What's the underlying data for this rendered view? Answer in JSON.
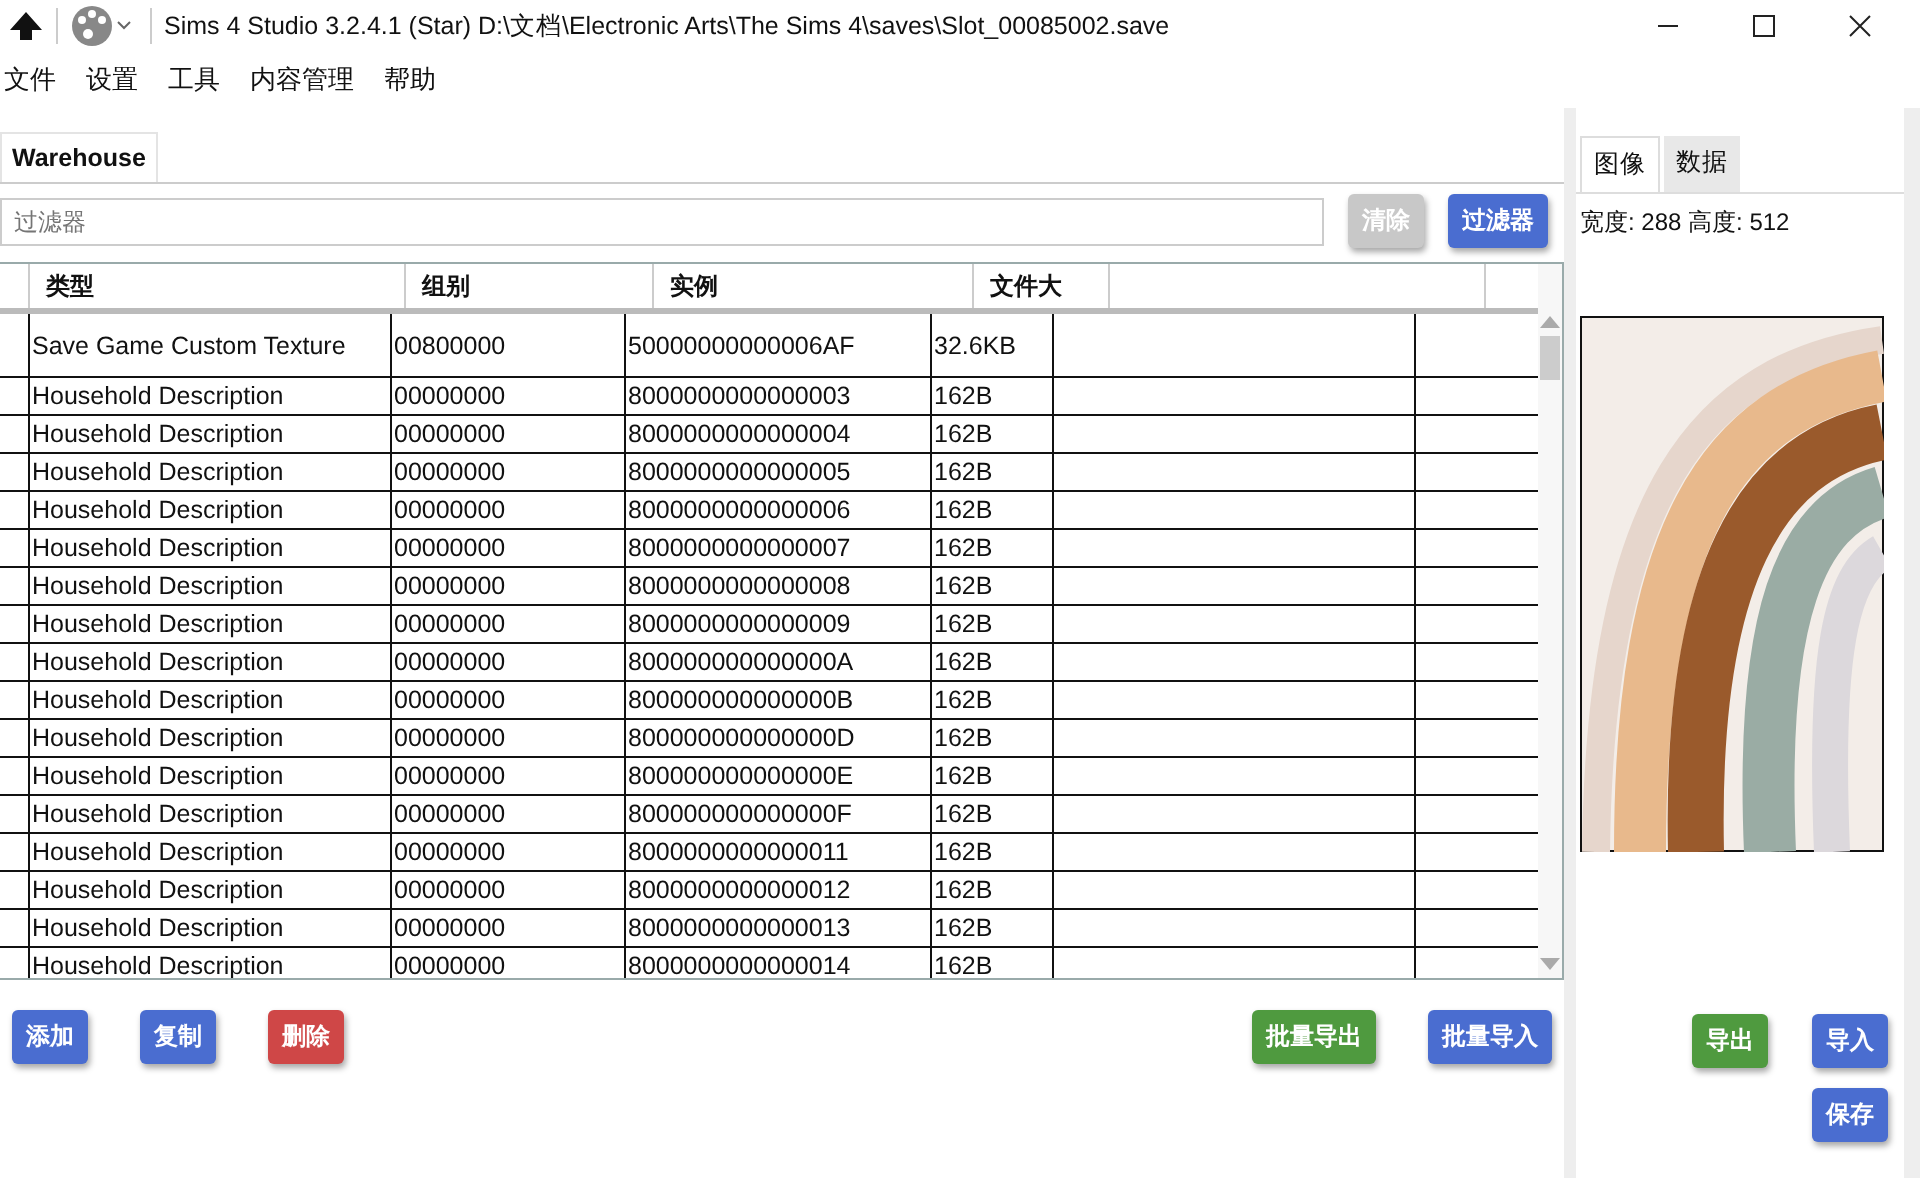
{
  "window": {
    "title": "Sims 4 Studio 3.2.4.1 (Star)  D:\\文档\\Electronic Arts\\The Sims 4\\saves\\Slot_00085002.save"
  },
  "menu": [
    "文件",
    "设置",
    "工具",
    "内容管理",
    "帮助"
  ],
  "tabs": [
    {
      "label": "Warehouse",
      "selected": true
    }
  ],
  "filter": {
    "placeholder": "过滤器",
    "clear_button": "清除",
    "filter_button": "过滤器"
  },
  "table": {
    "columns": [
      "类型",
      "组别",
      "实例",
      "文件大"
    ],
    "rows": [
      {
        "type": "Save Game Custom Texture",
        "group": "00800000",
        "instance": "50000000000006AF",
        "size": "32.6KB",
        "tall": true
      },
      {
        "type": "Household Description",
        "group": "00000000",
        "instance": "8000000000000003",
        "size": "162B",
        "tall": false
      },
      {
        "type": "Household Description",
        "group": "00000000",
        "instance": "8000000000000004",
        "size": "162B",
        "tall": false
      },
      {
        "type": "Household Description",
        "group": "00000000",
        "instance": "8000000000000005",
        "size": "162B",
        "tall": false
      },
      {
        "type": "Household Description",
        "group": "00000000",
        "instance": "8000000000000006",
        "size": "162B",
        "tall": false
      },
      {
        "type": "Household Description",
        "group": "00000000",
        "instance": "8000000000000007",
        "size": "162B",
        "tall": false
      },
      {
        "type": "Household Description",
        "group": "00000000",
        "instance": "8000000000000008",
        "size": "162B",
        "tall": false
      },
      {
        "type": "Household Description",
        "group": "00000000",
        "instance": "8000000000000009",
        "size": "162B",
        "tall": false
      },
      {
        "type": "Household Description",
        "group": "00000000",
        "instance": "800000000000000A",
        "size": "162B",
        "tall": false
      },
      {
        "type": "Household Description",
        "group": "00000000",
        "instance": "800000000000000B",
        "size": "162B",
        "tall": false
      },
      {
        "type": "Household Description",
        "group": "00000000",
        "instance": "800000000000000D",
        "size": "162B",
        "tall": false
      },
      {
        "type": "Household Description",
        "group": "00000000",
        "instance": "800000000000000E",
        "size": "162B",
        "tall": false
      },
      {
        "type": "Household Description",
        "group": "00000000",
        "instance": "800000000000000F",
        "size": "162B",
        "tall": false
      },
      {
        "type": "Household Description",
        "group": "00000000",
        "instance": "8000000000000011",
        "size": "162B",
        "tall": false
      },
      {
        "type": "Household Description",
        "group": "00000000",
        "instance": "8000000000000012",
        "size": "162B",
        "tall": false
      },
      {
        "type": "Household Description",
        "group": "00000000",
        "instance": "8000000000000013",
        "size": "162B",
        "tall": false
      },
      {
        "type": "Household Description",
        "group": "00000000",
        "instance": "8000000000000014",
        "size": "162B",
        "tall": false
      }
    ]
  },
  "actions": [
    {
      "label": "添加",
      "kind": "blue"
    },
    {
      "label": "复制",
      "kind": "blue"
    },
    {
      "label": "删除",
      "kind": "red"
    }
  ],
  "batch_actions": [
    {
      "label": "批量导出",
      "kind": "green"
    },
    {
      "label": "批量导入",
      "kind": "blue"
    }
  ],
  "preview": {
    "tabs": [
      {
        "label": "图像",
        "selected": true
      },
      {
        "label": "数据",
        "selected": false
      }
    ],
    "dimensions": "宽度: 288 高度: 512",
    "actions": [
      {
        "label": "导出",
        "kind": "green"
      },
      {
        "label": "导入",
        "kind": "blue"
      }
    ],
    "save_button": "保存"
  }
}
